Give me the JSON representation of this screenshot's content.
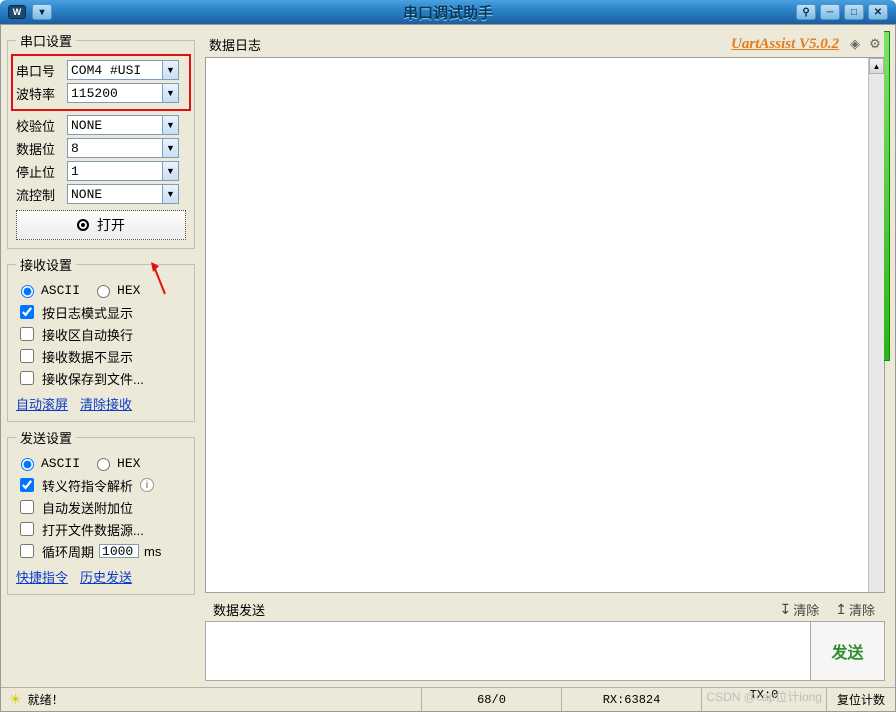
{
  "title": "串口调试助手",
  "logo": "W",
  "section_port": {
    "legend": "串口设置",
    "port_label": "串口号",
    "port_value": "COM4 #USI",
    "baud_label": "波特率",
    "baud_value": "115200",
    "parity_label": "校验位",
    "parity_value": "NONE",
    "databits_label": "数据位",
    "databits_value": "8",
    "stopbits_label": "停止位",
    "stopbits_value": "1",
    "flow_label": "流控制",
    "flow_value": "NONE",
    "open_button": "打开"
  },
  "section_recv": {
    "legend": "接收设置",
    "radio_ascii": "ASCII",
    "radio_hex": "HEX",
    "chk_logmode": "按日志模式显示",
    "chk_wrap": "接收区自动换行",
    "chk_hide": "接收数据不显示",
    "chk_save": "接收保存到文件...",
    "link_autoscroll": "自动滚屏",
    "link_clear": "清除接收"
  },
  "section_send": {
    "legend": "发送设置",
    "radio_ascii": "ASCII",
    "radio_hex": "HEX",
    "chk_escape": "转义符指令解析",
    "chk_autosend_extra": "自动发送附加位",
    "chk_openfile": "打开文件数据源...",
    "chk_cycle_label": "循环周期",
    "cycle_value": "1000",
    "cycle_unit": "ms",
    "link_shortcut": "快捷指令",
    "link_history": "历史发送"
  },
  "log_panel": {
    "title": "数据日志",
    "brand": "UartAssist V5.0.2"
  },
  "send_panel": {
    "title": "数据发送",
    "clear1": "清除",
    "clear2": "清除",
    "send_button": "发送"
  },
  "status": {
    "ready": "就绪！",
    "seg1": "68/0",
    "seg2": "RX:63824",
    "seg3": "TX:0",
    "watermark": "CSDN @cap位计iong",
    "reset": "复位计数"
  }
}
